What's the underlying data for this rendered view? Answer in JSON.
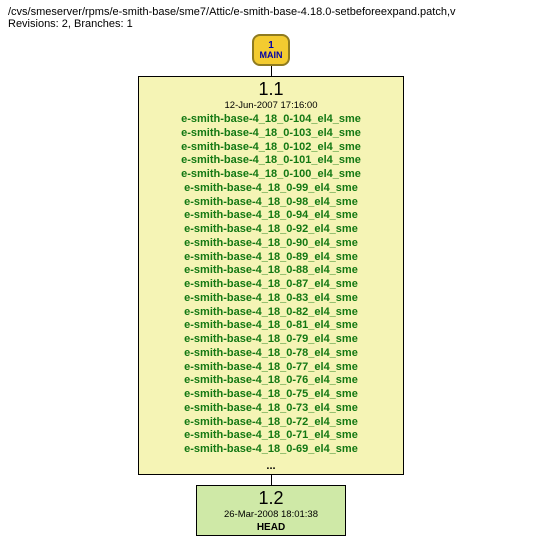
{
  "header": {
    "path": "/cvs/smeserver/rpms/e-smith-base/sme7/Attic/e-smith-base-4.18.0-setbeforeexpand.patch,v",
    "meta": "Revisions: 2, Branches: 1"
  },
  "badge": {
    "number": "1",
    "label": "MAIN"
  },
  "node1": {
    "version": "1.1",
    "date": "12-Jun-2007 17:16:00",
    "tags": [
      "e-smith-base-4_18_0-104_el4_sme",
      "e-smith-base-4_18_0-103_el4_sme",
      "e-smith-base-4_18_0-102_el4_sme",
      "e-smith-base-4_18_0-101_el4_sme",
      "e-smith-base-4_18_0-100_el4_sme",
      "e-smith-base-4_18_0-99_el4_sme",
      "e-smith-base-4_18_0-98_el4_sme",
      "e-smith-base-4_18_0-94_el4_sme",
      "e-smith-base-4_18_0-92_el4_sme",
      "e-smith-base-4_18_0-90_el4_sme",
      "e-smith-base-4_18_0-89_el4_sme",
      "e-smith-base-4_18_0-88_el4_sme",
      "e-smith-base-4_18_0-87_el4_sme",
      "e-smith-base-4_18_0-83_el4_sme",
      "e-smith-base-4_18_0-82_el4_sme",
      "e-smith-base-4_18_0-81_el4_sme",
      "e-smith-base-4_18_0-79_el4_sme",
      "e-smith-base-4_18_0-78_el4_sme",
      "e-smith-base-4_18_0-77_el4_sme",
      "e-smith-base-4_18_0-76_el4_sme",
      "e-smith-base-4_18_0-75_el4_sme",
      "e-smith-base-4_18_0-73_el4_sme",
      "e-smith-base-4_18_0-72_el4_sme",
      "e-smith-base-4_18_0-71_el4_sme",
      "e-smith-base-4_18_0-69_el4_sme"
    ],
    "ellipsis": "..."
  },
  "node2": {
    "version": "1.2",
    "date": "26-Mar-2008 18:01:38",
    "head": "HEAD"
  }
}
